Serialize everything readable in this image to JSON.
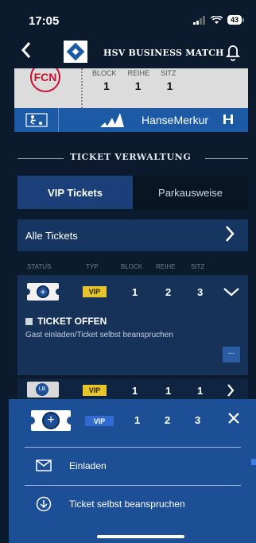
{
  "status_bar": {
    "time": "17:05",
    "battery": "43"
  },
  "header": {
    "title": "HSV BUSINESS MATCH",
    "back_icon": "chevron-left-icon",
    "bell_icon": "bell-icon"
  },
  "ticket_card": {
    "badge_text": "FCN",
    "heads": [
      "BLOCK",
      "REIHE",
      "SITZ"
    ],
    "values": [
      "1",
      "1",
      "1"
    ]
  },
  "sponsors": {
    "hanse": "HanseMerkur"
  },
  "section_title": "TICKET VERWALTUNG",
  "tabs": [
    {
      "label": "VIP Tickets",
      "active": true
    },
    {
      "label": "Parkausweise",
      "active": false
    }
  ],
  "filter": {
    "label": "Alle Tickets"
  },
  "columns": [
    "STATUS",
    "TYP",
    "BLOCK",
    "REIHE",
    "SITZ"
  ],
  "tickets": [
    {
      "type": "VIP",
      "block": "1",
      "row": "2",
      "seat": "3",
      "status_label": "TICKET OFFEN",
      "description": "Gast einladen/Ticket selbst beanspruchen",
      "more": "..."
    },
    {
      "badge": "LB",
      "type": "VIP",
      "block": "1",
      "row": "1",
      "seat": "1"
    }
  ],
  "sheet": {
    "type": "VIP",
    "block": "1",
    "row": "2",
    "seat": "3",
    "actions": [
      {
        "label": "Einladen",
        "icon": "mail-icon"
      },
      {
        "label": "Ticket selbst beanspruchen",
        "icon": "download-circle-icon"
      }
    ]
  },
  "colors": {
    "background": "#0c1a2d",
    "accent": "#1d5aa6",
    "vip": "#e5c52b"
  }
}
